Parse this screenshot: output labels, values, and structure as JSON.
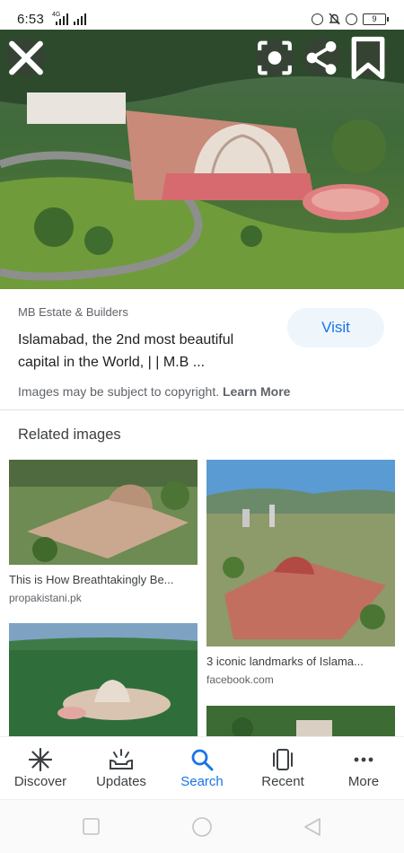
{
  "status_bar": {
    "time": "6:53",
    "network": "4G",
    "battery": "9"
  },
  "hero_actions": {
    "close_icon": "close-icon",
    "lens_icon": "lens-icon",
    "share_icon": "share-icon",
    "bookmark_icon": "bookmark-icon"
  },
  "result": {
    "source": "MB Estate & Builders",
    "caption": "Islamabad, the 2nd most beautiful capital in the World, | | M.B ...",
    "visit_label": "Visit",
    "copyright_text": "Images may be subject to copyright.",
    "learn_more_label": "Learn More"
  },
  "related": {
    "title": "Related images",
    "items": [
      {
        "title": "This is How Breathtakingly Be...",
        "site": "propakistani.pk"
      },
      {
        "title": "3 iconic landmarks of Islama...",
        "site": "facebook.com"
      },
      {
        "title": "",
        "site": ""
      },
      {
        "title": "",
        "site": ""
      }
    ]
  },
  "bottom_nav": {
    "items": [
      {
        "label": "Discover",
        "icon": "asterisk-icon"
      },
      {
        "label": "Updates",
        "icon": "updates-icon"
      },
      {
        "label": "Search",
        "icon": "search-icon"
      },
      {
        "label": "Recent",
        "icon": "recent-icon"
      },
      {
        "label": "More",
        "icon": "more-icon"
      }
    ],
    "active": "Search"
  },
  "system_nav": {
    "square": "recents-square-icon",
    "circle": "home-circle-icon",
    "triangle": "back-triangle-icon"
  },
  "colors": {
    "accent": "#1a73e8",
    "visit_bg": "#eef6fb"
  }
}
